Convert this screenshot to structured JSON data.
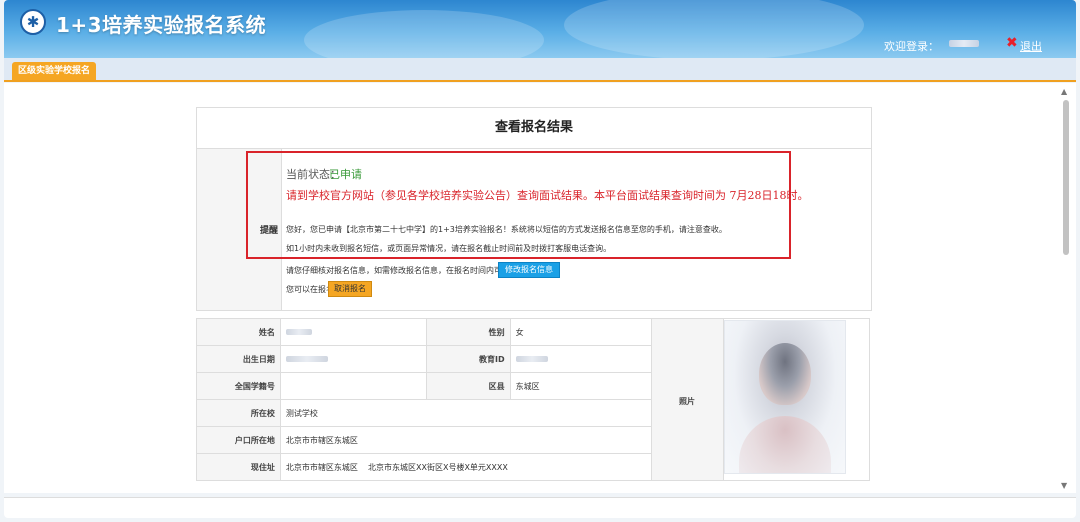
{
  "header": {
    "title": "1+3培养实验报名系统",
    "welcome_label": "欢迎登录：",
    "logout_label": "退出"
  },
  "tabs": [
    {
      "label": "区级实验学校报名"
    }
  ],
  "result_panel": {
    "title": "查看报名结果",
    "remind_label": "提醒",
    "status_label": "当前状态：",
    "status_value": "已申请",
    "notice": "请到学校官方网站（参见各学校培养实验公告）查询面试结果。本平台面试结果查询时间为 7月28日18时。",
    "message_1": "您好，您已申请【北京市第二十七中学】的1+3培养实验报名！系统将以短信的方式发送报名信息至您的手机，请注意查收。",
    "message_2": "如1小时内未收到报名短信，或页面异常情况，请在报名截止时间前及时拨打客服电话查询。",
    "modify_hint": "请您仔细核对报名信息，如需修改报名信息，在报名时间内可",
    "modify_button": "修改报名信息",
    "cancel_hint": "您可以在报名时间内",
    "cancel_button": "取消报名"
  },
  "student_info": {
    "name_label": "姓名",
    "gender_label": "性别",
    "gender_value": "女",
    "birth_label": "出生日期",
    "edu_id_label": "教育ID",
    "student_no_label": "全国学籍号",
    "district_label": "区县",
    "district_value": "东城区",
    "school_label": "所在校",
    "school_value": "测试学校",
    "hukou_label": "户口所在地",
    "hukou_value": "北京市市辖区东城区",
    "address_label": "现住址",
    "address_value": "北京市市辖区东城区    北京市东城区XX街区X号楼X单元XXXX",
    "photo_label": "照片"
  },
  "colors": {
    "header_blue": "#2d86d0",
    "tab_orange": "#f5a623",
    "alert_red": "#d9232a",
    "status_green": "#3a9a3a",
    "modify_button_blue": "#1aa0e6"
  },
  "icons": {
    "logo": "emblem-icon",
    "logout": "close-x-icon"
  }
}
